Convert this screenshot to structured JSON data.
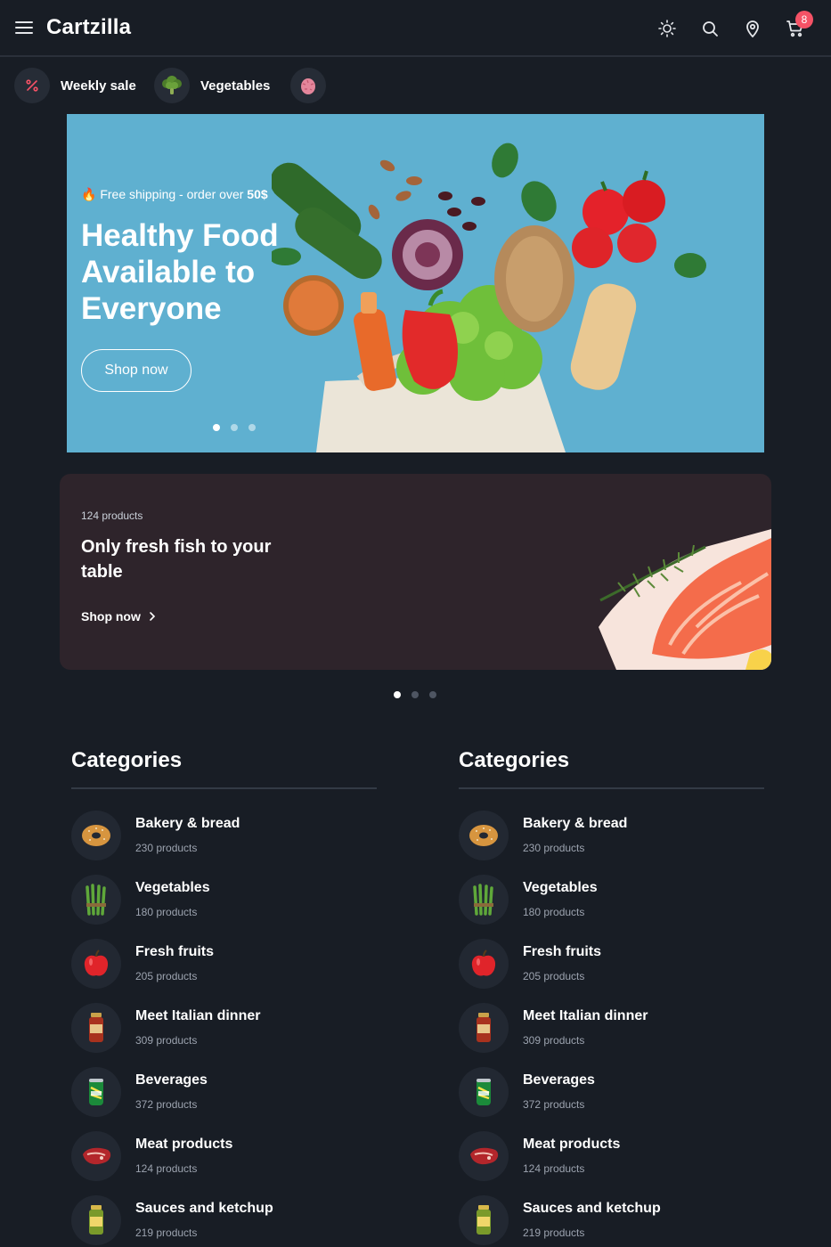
{
  "header": {
    "brand": "Cartzilla",
    "cart_count": "8",
    "icons": [
      "menu-icon",
      "sun-icon",
      "search-icon",
      "location-pin-icon",
      "cart-icon"
    ]
  },
  "chips": [
    {
      "label": "Weekly sale",
      "icon": "percent-icon"
    },
    {
      "label": "Vegetables",
      "icon": "broccoli-icon"
    },
    {
      "label": "",
      "icon": "dragon-fruit-icon"
    }
  ],
  "hero": {
    "promo_prefix": "Free shipping - order over ",
    "promo_amount": "50$",
    "title": "Healthy Food Available to Everyone",
    "button": "Shop now",
    "slides": 3,
    "active_slide": 1
  },
  "promo": {
    "count": "124 products",
    "title": "Only fresh fish to your table",
    "link": "Shop now",
    "slides": 3,
    "active_slide": 1
  },
  "categories": [
    {
      "heading": "Categories",
      "items": [
        {
          "name": "Bakery & bread",
          "count": "230 products",
          "icon": "bagel-icon"
        },
        {
          "name": "Vegetables",
          "count": "180 products",
          "icon": "asparagus-icon"
        },
        {
          "name": "Fresh fruits",
          "count": "205 products",
          "icon": "apple-icon"
        },
        {
          "name": "Meet Italian dinner",
          "count": "309 products",
          "icon": "sauce-jar-icon"
        },
        {
          "name": "Beverages",
          "count": "372 products",
          "icon": "soda-can-icon"
        },
        {
          "name": "Meat products",
          "count": "124 products",
          "icon": "steak-icon"
        },
        {
          "name": "Sauces and ketchup",
          "count": "219 products",
          "icon": "ketchup-jar-icon"
        }
      ]
    },
    {
      "heading": "Categories",
      "items": [
        {
          "name": "Bakery & bread",
          "count": "230 products",
          "icon": "bagel-icon"
        },
        {
          "name": "Vegetables",
          "count": "180 products",
          "icon": "asparagus-icon"
        },
        {
          "name": "Fresh fruits",
          "count": "205 products",
          "icon": "apple-icon"
        },
        {
          "name": "Meet Italian dinner",
          "count": "309 products",
          "icon": "sauce-jar-icon"
        },
        {
          "name": "Beverages",
          "count": "372 products",
          "icon": "soda-can-icon"
        },
        {
          "name": "Meat products",
          "count": "124 products",
          "icon": "steak-icon"
        },
        {
          "name": "Sauces and ketchup",
          "count": "219 products",
          "icon": "ketchup-jar-icon"
        }
      ]
    }
  ]
}
